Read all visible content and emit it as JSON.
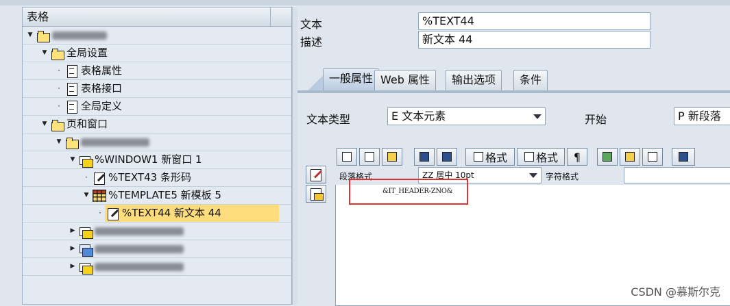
{
  "tree": {
    "header": "表格",
    "nodes": [
      {
        "label": "",
        "depth": 0,
        "toggle": "expanded",
        "icon": "folder-icon",
        "blurred": true
      },
      {
        "label": "全局设置",
        "depth": 1,
        "toggle": "expanded",
        "icon": "folder-icon"
      },
      {
        "label": "表格属性",
        "depth": 2,
        "toggle": "leaf",
        "icon": "document-icon"
      },
      {
        "label": "表格接口",
        "depth": 2,
        "toggle": "leaf",
        "icon": "document-icon"
      },
      {
        "label": "全局定义",
        "depth": 2,
        "toggle": "leaf",
        "icon": "document-icon"
      },
      {
        "label": "页和窗口",
        "depth": 1,
        "toggle": "expanded",
        "icon": "folder-icon"
      },
      {
        "label": "",
        "depth": 2,
        "toggle": "expanded",
        "icon": "folder-icon",
        "blurred": true
      },
      {
        "label": "%WINDOW1 新窗口 1",
        "depth": 3,
        "toggle": "expanded",
        "icon": "window-icon"
      },
      {
        "label": "%TEXT43 条形码",
        "depth": 4,
        "toggle": "leaf",
        "icon": "text-edit-icon"
      },
      {
        "label": "%TEMPLATE5 新模板 5",
        "depth": 4,
        "toggle": "expanded",
        "icon": "template-grid-icon"
      },
      {
        "label": "%TEXT44 新文本 44",
        "depth": 5,
        "toggle": "leaf",
        "icon": "text-edit-icon",
        "selected": true
      },
      {
        "label": "",
        "depth": 3,
        "toggle": "collapsed",
        "icon": "window-icon",
        "blurred": true
      },
      {
        "label": "",
        "depth": 3,
        "toggle": "collapsed",
        "icon": "main-window-icon",
        "blurred": true
      },
      {
        "label": "",
        "depth": 3,
        "toggle": "collapsed",
        "icon": "window-icon",
        "blurred": true
      }
    ]
  },
  "form": {
    "text_label": "文本",
    "text_value": "%TEXT44",
    "desc_label": "描述",
    "desc_value": "新文本 44"
  },
  "tabs": [
    {
      "label": "一般属性",
      "active": true
    },
    {
      "label": "Web 属性",
      "active": false
    },
    {
      "label": "输出选项",
      "active": false
    },
    {
      "label": "条件",
      "active": false
    }
  ],
  "general": {
    "text_type_label": "文本类型",
    "text_type_value": "E 文本元素",
    "start_label": "开始",
    "start_value": "P 新段落"
  },
  "toolbar": {
    "format_label_1": "格式",
    "format_label_2": "格式",
    "paragraph_mark": "¶"
  },
  "editor": {
    "para_format_label": "段落格式",
    "para_format_value": "ZZ 居中 10pt",
    "char_format_label": "字符格式",
    "char_format_value": "",
    "content": "&IT_HEADER-ZNO&"
  },
  "watermark": "CSDN @慕斯尔克",
  "colors": {
    "selection": "#fddc7e",
    "highlight_box": "#e13232"
  }
}
